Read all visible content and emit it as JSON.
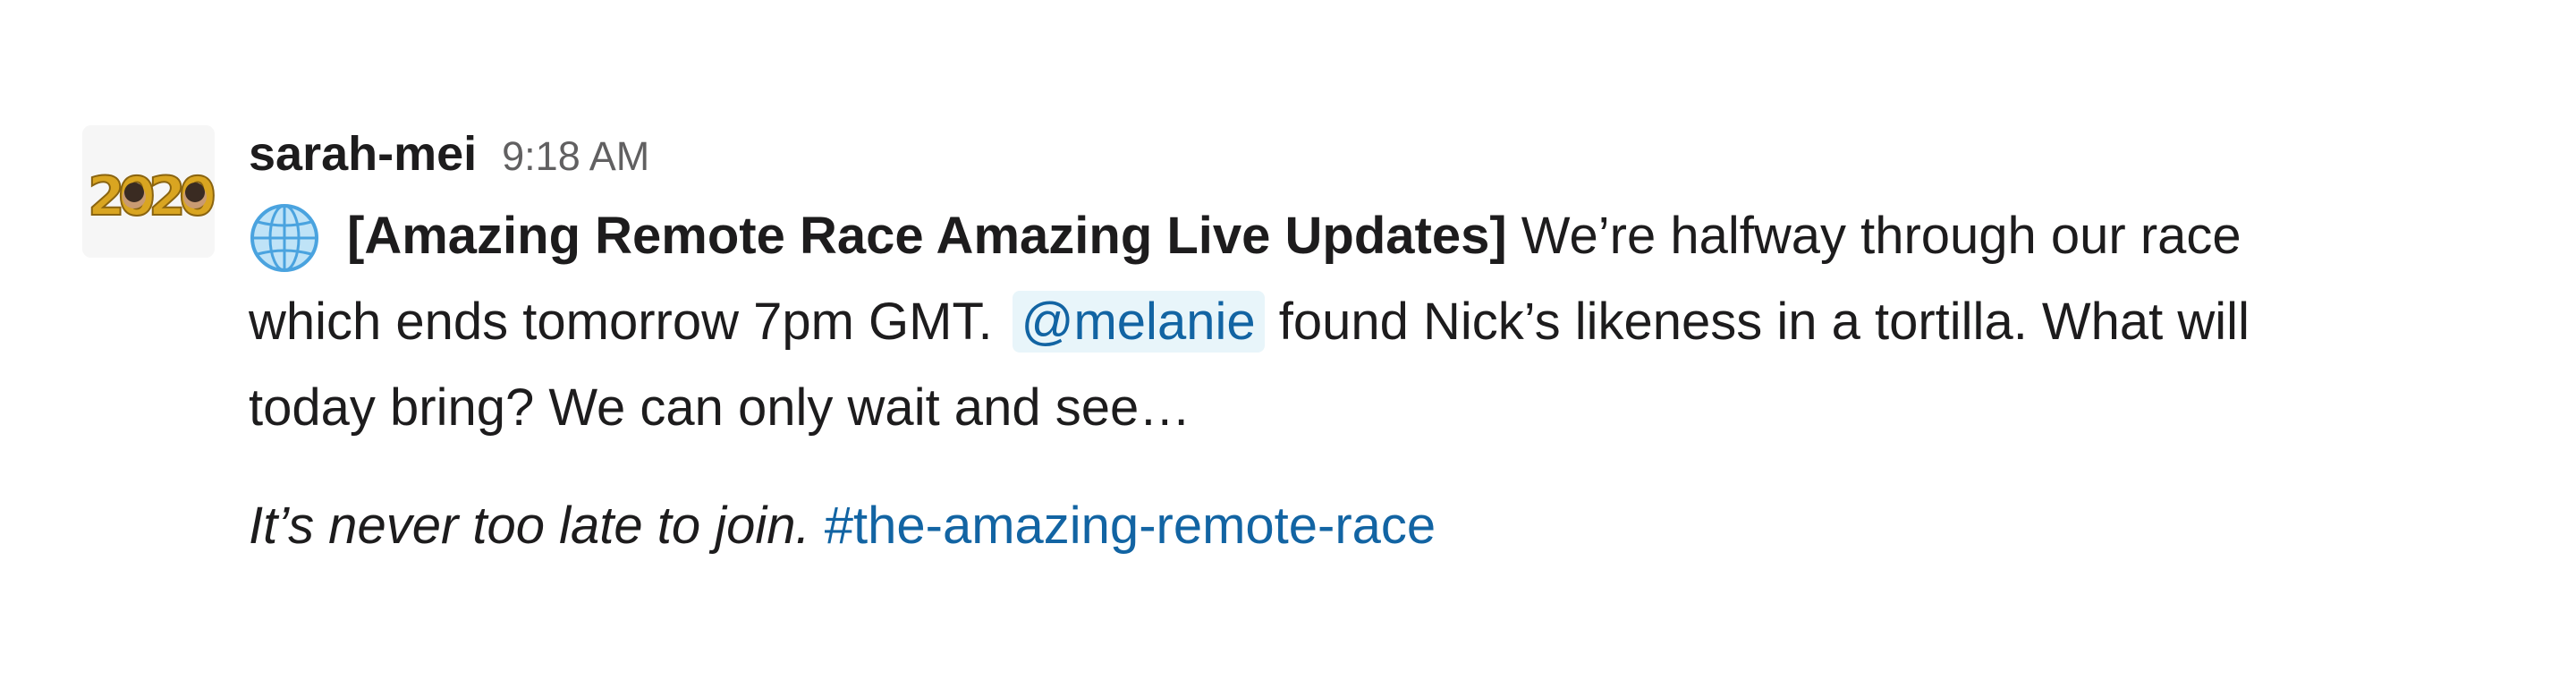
{
  "message": {
    "sender": "sarah-mei",
    "timestamp": "9:18 AM",
    "avatar": {
      "icon": "balloons-2020-avatar",
      "text": "2020"
    },
    "lead_emoji": "globe-icon",
    "title": "[Amazing Remote Race Amazing Live Updates]",
    "line1_rest": " We’re halfway through our race",
    "line2_start": "which ends tomorrow 7pm GMT.",
    "mention": "@melanie",
    "line2_end": " found Nick’s likeness in a tortilla. What will",
    "line3": "today bring? We can only wait and see…",
    "footer_italic": "It’s never too late to join.",
    "channel": "#the-amazing-remote-race"
  },
  "colors": {
    "text": "#1d1c1d",
    "timestamp": "#616061",
    "link": "#1264a3",
    "mention_bg": "#e8f5fa",
    "balloon_gold": "#d9a521"
  }
}
